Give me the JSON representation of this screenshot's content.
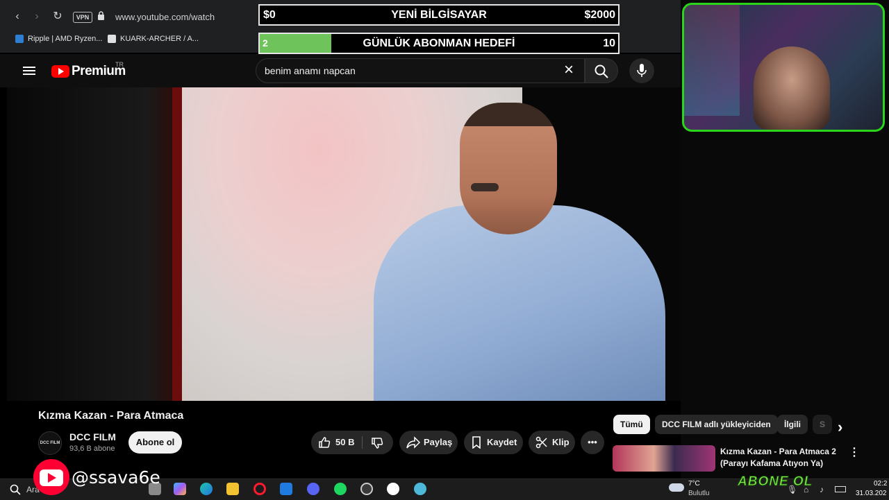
{
  "browser": {
    "url": "www.youtube.com/watch",
    "vpn_label": "VPN",
    "bookmarks": [
      {
        "label": "Ripple | AMD Ryzen..."
      },
      {
        "label": "KUARK-ARCHER / A..."
      }
    ]
  },
  "overlay": {
    "goal": {
      "left": "$0",
      "title": "YENİ BİLGİSAYAR",
      "right": "$2000"
    },
    "subs": {
      "current": "2",
      "title": "GÜNLÜK ABONMAN HEDEFİ",
      "target": "10",
      "progress_fraction": 0.2
    },
    "handle": "@ssava6e",
    "abone_text": "ABONE OL"
  },
  "youtube": {
    "logo_text": "Premium",
    "region": "TR",
    "search_value": "benim anamı napcan",
    "video_title": "Kızma Kazan - Para Atmaca",
    "channel": {
      "name": "DCC FILM",
      "subscribers": "93,6 B abone",
      "avatar_text": "DCC FILM"
    },
    "subscribe_label": "Abone ol",
    "actions": {
      "likes": "50 B",
      "share": "Paylaş",
      "save": "Kaydet",
      "clip": "Klip"
    },
    "chips": [
      "Tümü",
      "DCC FILM adlı yükleyiciden",
      "İlgili",
      "S"
    ],
    "related": {
      "title": "Kızma Kazan - Para Atmaca 2 (Parayı Kafama Atıyon Ya)"
    }
  },
  "taskbar": {
    "search_label": "Ara",
    "weather_temp": "7°C",
    "weather_desc": "Bulutlu",
    "time": "02:2",
    "date": "31.03.202"
  }
}
